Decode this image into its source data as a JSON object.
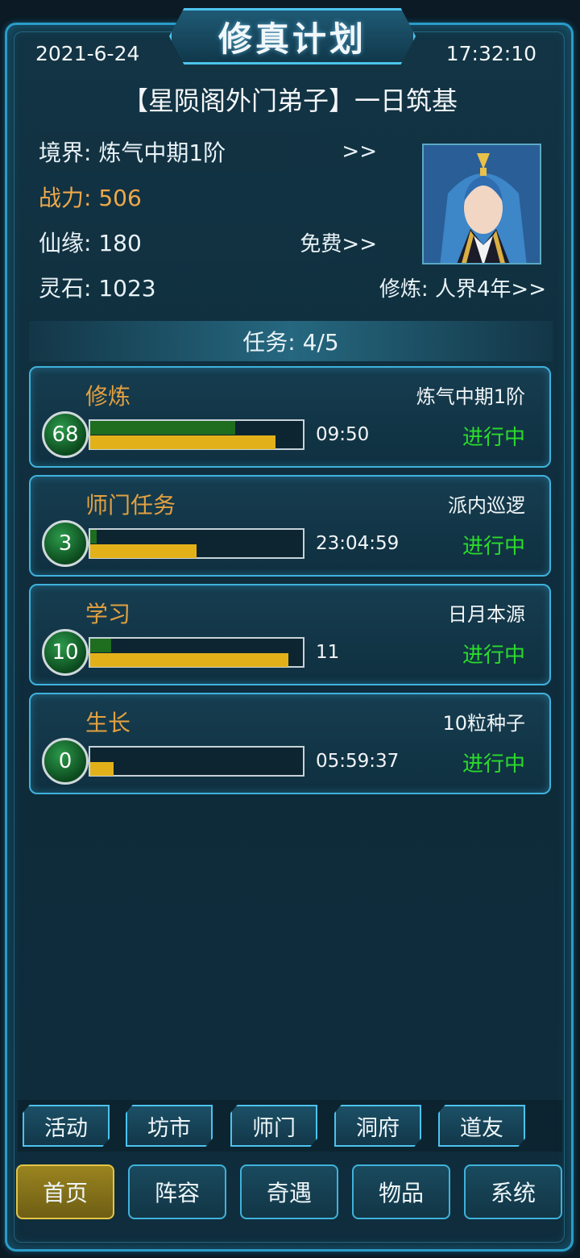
{
  "header": {
    "title": "修真计划",
    "date": "2021-6-24",
    "time": "17:32:10",
    "subtitle": "【星陨阁外门弟子】一日筑基"
  },
  "stats": {
    "realm": "境界: 炼气中期1阶",
    "realm_link": ">>",
    "power": "战力: 506",
    "fortune": "仙缘: 180",
    "fortune_link": "免费>>",
    "spirit_stones": "灵石: 1023",
    "cultivation": "修炼: 人界4年>>"
  },
  "tasks_header": "任务: 4/5",
  "tasks": [
    {
      "name": "修炼",
      "detail": "炼气中期1阶",
      "level": "68",
      "time": "09:50",
      "status": "进行中",
      "green_fill": 0.68,
      "yellow_fill": 0.87
    },
    {
      "name": "师门任务",
      "detail": "派内巡逻",
      "level": "3",
      "time": "23:04:59",
      "status": "进行中",
      "green_fill": 0.03,
      "yellow_fill": 0.5
    },
    {
      "name": "学习",
      "detail": "日月本源",
      "level": "10",
      "time": "11",
      "status": "进行中",
      "green_fill": 0.1,
      "yellow_fill": 0.93
    },
    {
      "name": "生长",
      "detail": "10粒种子",
      "level": "0",
      "time": "05:59:37",
      "status": "进行中",
      "green_fill": 0.0,
      "yellow_fill": 0.11
    }
  ],
  "subnav": [
    "活动",
    "坊市",
    "师门",
    "洞府",
    "道友"
  ],
  "nav": [
    "首页",
    "阵容",
    "奇遇",
    "物品",
    "系统"
  ],
  "colors": {
    "accent": "#3fb2dc",
    "status": "#2bdc2b",
    "task_name": "#e3a040",
    "power": "#f0a84a",
    "bar_yellow": "#e2b11a",
    "bar_green": "#1f6d1e"
  }
}
